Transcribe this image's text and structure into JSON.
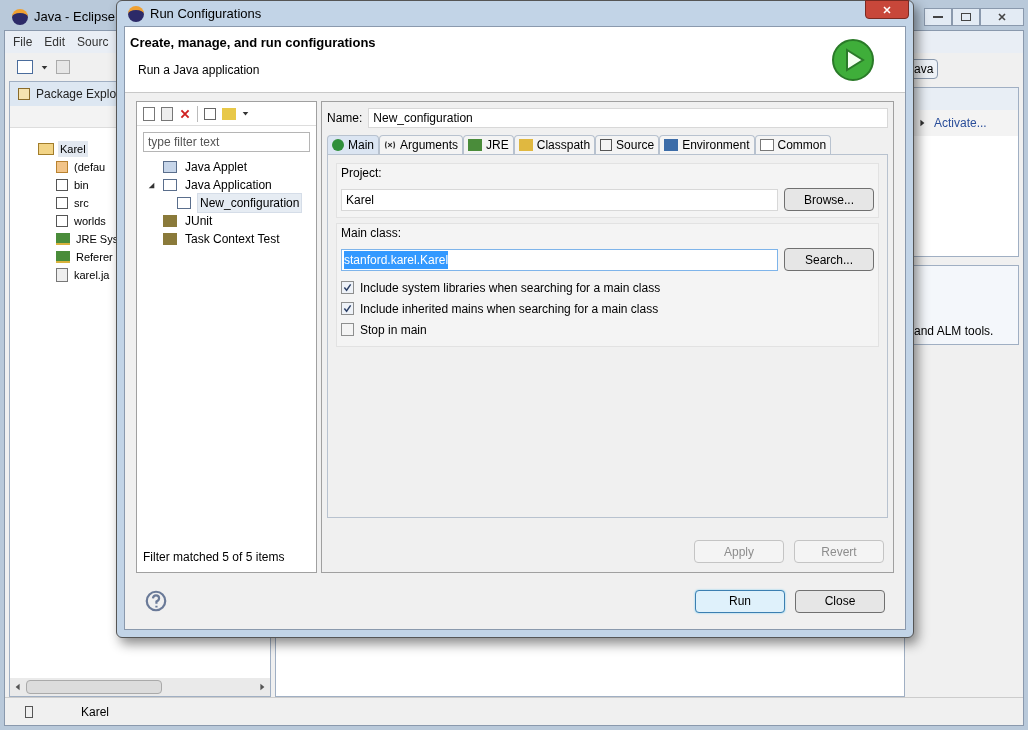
{
  "eclipse": {
    "title": "Java - Eclipse",
    "menu": [
      "File",
      "Edit",
      "Sourc"
    ],
    "explorer": {
      "tab": "Package Explo",
      "tree": {
        "label": "Karel",
        "selected": true,
        "children": [
          {
            "kind": "package",
            "label": "(defau"
          },
          {
            "kind": "folder",
            "label": "bin"
          },
          {
            "kind": "folder",
            "label": "src"
          },
          {
            "kind": "folder",
            "label": "worlds"
          },
          {
            "kind": "library",
            "label": "JRE Sys"
          },
          {
            "kind": "library",
            "label": "Referer"
          },
          {
            "kind": "jar",
            "label": "karel.ja"
          }
        ]
      }
    },
    "perspective": "ava",
    "activate": "Activate...",
    "alm_text": "and ALM tools.",
    "status": "Karel"
  },
  "dialog": {
    "title": "Run Configurations",
    "heading": "Create, manage, and run configurations",
    "subheading": "Run a Java application",
    "filter": {
      "placeholder": "type filter text"
    },
    "tree": [
      {
        "label": "Java Applet",
        "selected": false
      },
      {
        "label": "Java Application",
        "selected": false,
        "expanded": true,
        "children": [
          {
            "label": "New_configuration",
            "selected": true
          }
        ]
      },
      {
        "label": "JUnit",
        "selected": false
      },
      {
        "label": "Task Context Test",
        "selected": false
      }
    ],
    "filter_status": "Filter matched 5 of 5 items",
    "name_label": "Name:",
    "name_value": "New_configuration",
    "tabs": [
      {
        "label": "Main",
        "selected": true
      },
      {
        "label": "Arguments",
        "selected": false
      },
      {
        "label": "JRE",
        "selected": false
      },
      {
        "label": "Classpath",
        "selected": false
      },
      {
        "label": "Source",
        "selected": false
      },
      {
        "label": "Environment",
        "selected": false
      },
      {
        "label": "Common",
        "selected": false
      }
    ],
    "project": {
      "label": "Project:",
      "value": "Karel",
      "button": "Browse..."
    },
    "main_class": {
      "label": "Main class:",
      "value": "stanford.karel.Karel",
      "text_selected": true,
      "button": "Search..."
    },
    "options": [
      {
        "label": "Include system libraries when searching for a main class",
        "checked": true
      },
      {
        "label": "Include inherited mains when searching for a main class",
        "checked": true
      },
      {
        "label": "Stop in main",
        "checked": false
      }
    ],
    "apply_buttons": [
      {
        "label": "Apply",
        "disabled": true
      },
      {
        "label": "Revert",
        "disabled": true
      }
    ],
    "footer_buttons": [
      {
        "label": "Run",
        "default": true
      },
      {
        "label": "Close",
        "default": false
      }
    ]
  }
}
